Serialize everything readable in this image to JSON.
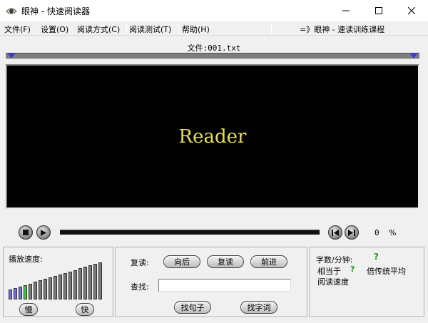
{
  "window": {
    "title": "眼神 - 快速阅读器",
    "minimize_icon": "minimize-icon",
    "maximize_icon": "maximize-icon",
    "close_icon": "close-icon"
  },
  "menu": {
    "items": [
      "文件(F)",
      "设置(O)",
      "阅读方式(C)",
      "阅读测试(T)",
      "帮助(H)"
    ],
    "right_text": "=》眼神 - 速读训练课程"
  },
  "file": {
    "label": "文件:001.txt"
  },
  "display": {
    "text": "Reader",
    "text_color": "#e6df5a",
    "background": "#000000"
  },
  "controls": {
    "stop_icon": "stop-icon",
    "play_icon": "play-icon",
    "prev_icon": "prev-icon",
    "next_icon": "next-icon",
    "percent_value": "0",
    "percent_sign": "%"
  },
  "speed": {
    "label": "播放速度:",
    "bar_count": 19,
    "current_level": 4,
    "slow_label": "慢",
    "fast_label": "快"
  },
  "reread": {
    "label": "复读:",
    "back_button": "向后",
    "reread_button": "复读",
    "forward_button": "前进"
  },
  "search": {
    "label": "查找:",
    "value": "",
    "find_sentence_button": "找句子",
    "find_word_button": "找字词"
  },
  "stats": {
    "wpm_label": "字数/分钟:",
    "wpm_value": "?",
    "equiv_label": "相当于",
    "equiv_value": "?",
    "avg_label": "倍传统平均",
    "speed_label": "阅读速度"
  }
}
